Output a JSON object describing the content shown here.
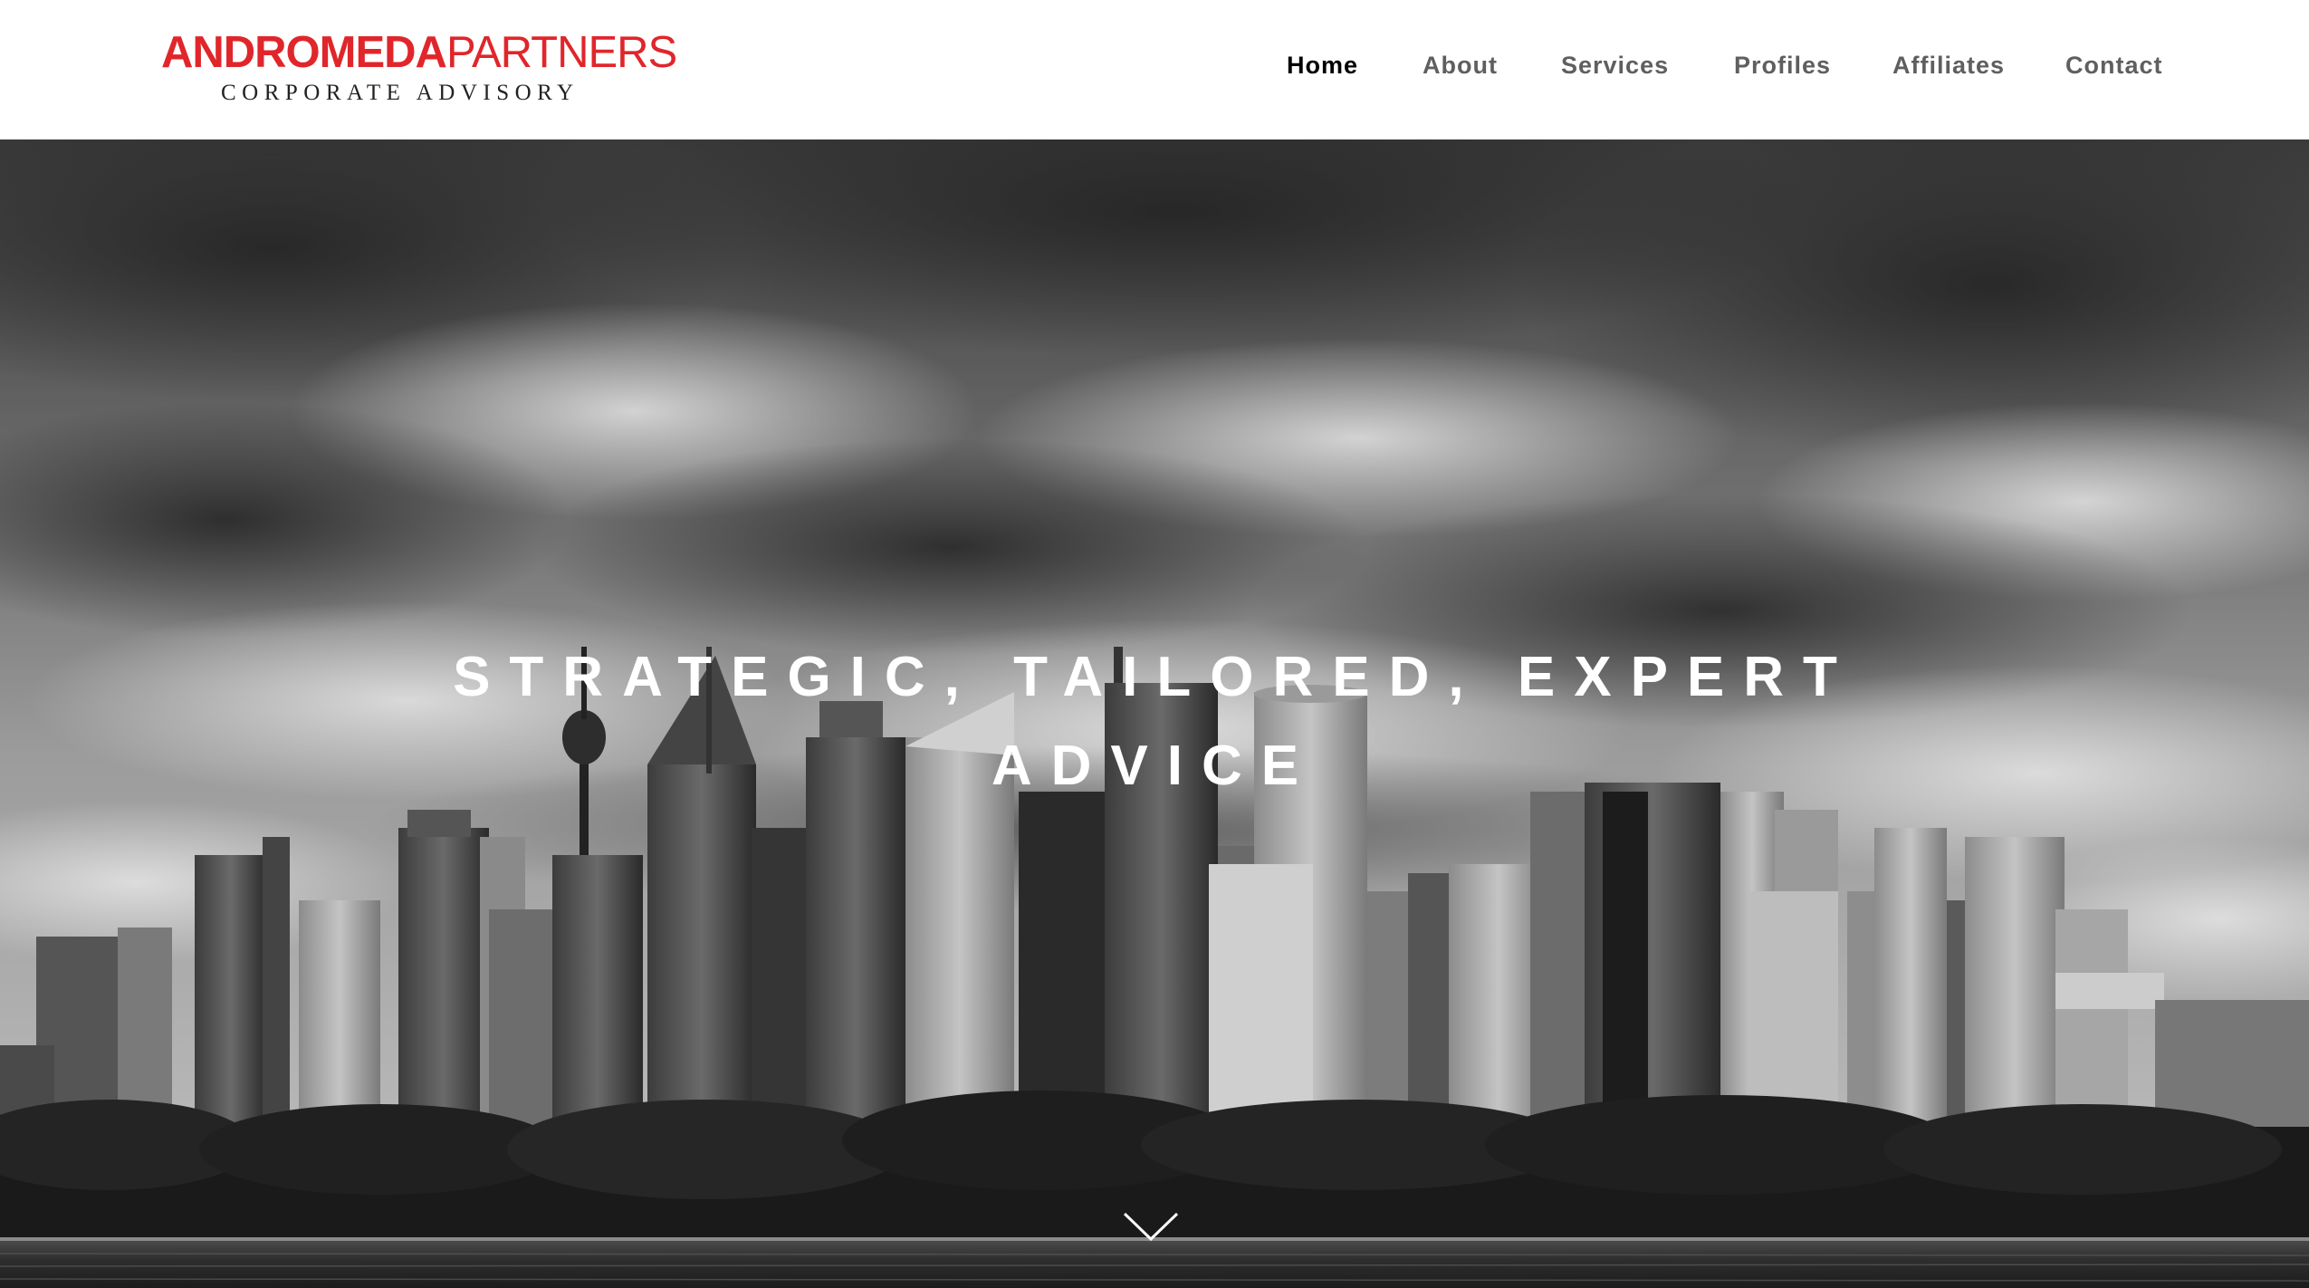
{
  "brand": {
    "name_bold": "ANDROMEDA",
    "name_light": "PARTNERS",
    "tagline": "CORPORATE ADVISORY",
    "color": "#e0262b"
  },
  "nav": {
    "items": [
      {
        "label": "Home",
        "active": true
      },
      {
        "label": "About",
        "active": false
      },
      {
        "label": "Services",
        "active": false
      },
      {
        "label": "Profiles",
        "active": false
      },
      {
        "label": "Affiliates",
        "active": false
      },
      {
        "label": "Contact",
        "active": false
      }
    ]
  },
  "hero": {
    "headline_line1": "STRATEGIC, TAILORED, EXPERT",
    "headline_line2": "ADVICE",
    "scroll_icon": "chevron-down-icon"
  }
}
